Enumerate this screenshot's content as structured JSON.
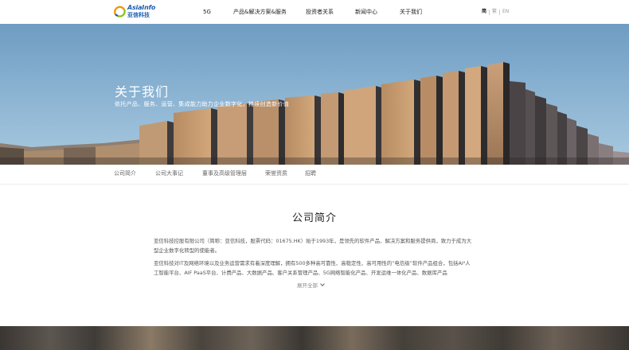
{
  "header": {
    "logo": {
      "name_en": "AsiaInfo",
      "name_cn": "亚信科技"
    },
    "nav": [
      "5G",
      "产品&解决方案&服务",
      "投资者关系",
      "新闻中心",
      "关于我们"
    ],
    "lang": {
      "simplified": "简",
      "traditional": "繁",
      "english": "EN"
    }
  },
  "hero": {
    "title": "关于我们",
    "subtitle": "依托产品、服务、运营、集成能力助力企业数字化，持续创造新价值"
  },
  "subnav": [
    "公司简介",
    "公司大事记",
    "董事及高级管理层",
    "荣誉资质",
    "招聘"
  ],
  "intro": {
    "title": "公司简介",
    "p1": "亚信科技控股有限公司（简称：亚信科技，股票代码：01675.HK）始于1993年，是领先的软件产品、解决方案和服务提供商，致力于成为大型企业数字化转型的使能者。",
    "p2": "亚信科技对IT及网络环境以及业务运营需求有着深度理解，拥有500多种高可靠性、高稳定性、高可用性的“电信级”软件产品组合，包括AI²人工智能平台、AIF PaaS平台、计费产品、大数据产品、客户关系管理产品、5G网络智能化产品、开发运维一体化产品、数据库产品",
    "expand": "展开全部"
  },
  "colors": {
    "brand_blue": "#1b5fb3",
    "logo_orange": "#f39800",
    "logo_green": "#8dc21f"
  }
}
